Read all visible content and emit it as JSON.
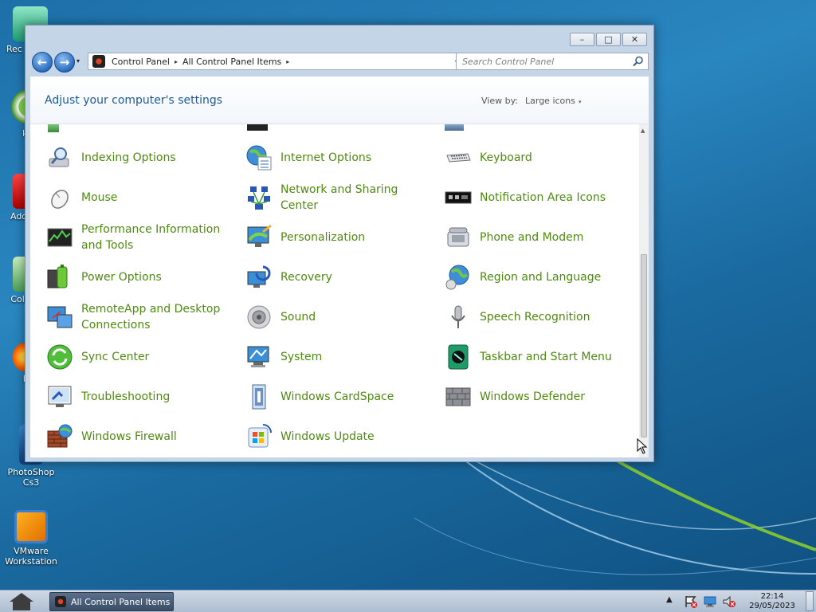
{
  "desktop": {
    "icons": [
      {
        "label": "Rec"
      },
      {
        "label": "µT"
      },
      {
        "label": "Adob"
      },
      {
        "label": "Colla"
      },
      {
        "label": "Fi"
      },
      {
        "label": "PhotoShop Cs3"
      },
      {
        "label": "VMware Workstation"
      }
    ]
  },
  "window": {
    "caption_buttons": {
      "minimize": "–",
      "maximize": "□",
      "close": "✕"
    },
    "nav": {
      "back": "←",
      "forward": "→",
      "dropdown": "▾"
    },
    "address": {
      "crumbs": [
        "Control Panel",
        "All Control Panel Items"
      ],
      "separator": "▸",
      "dropdown": "▾",
      "refresh": "⇆"
    },
    "search": {
      "placeholder": "Search Control Panel"
    },
    "header": {
      "title": "Adjust your computer's settings",
      "view_by_label": "View by:",
      "view_by_value": "Large icons",
      "view_by_caret": "▾"
    },
    "items": [
      {
        "label": "Indexing Options",
        "icon": "indexing-icon"
      },
      {
        "label": "Internet Options",
        "icon": "internet-options-icon"
      },
      {
        "label": "Keyboard",
        "icon": "keyboard-icon"
      },
      {
        "label": "Mouse",
        "icon": "mouse-icon"
      },
      {
        "label": "Network and Sharing Center",
        "icon": "network-icon"
      },
      {
        "label": "Notification Area Icons",
        "icon": "notification-icon"
      },
      {
        "label": "Performance Information and Tools",
        "icon": "performance-icon"
      },
      {
        "label": "Personalization",
        "icon": "personalization-icon"
      },
      {
        "label": "Phone and Modem",
        "icon": "phone-icon"
      },
      {
        "label": "Power Options",
        "icon": "power-icon"
      },
      {
        "label": "Recovery",
        "icon": "recovery-icon"
      },
      {
        "label": "Region and Language",
        "icon": "region-icon"
      },
      {
        "label": "RemoteApp and Desktop Connections",
        "icon": "remoteapp-icon"
      },
      {
        "label": "Sound",
        "icon": "sound-icon"
      },
      {
        "label": "Speech Recognition",
        "icon": "microphone-icon"
      },
      {
        "label": "Sync Center",
        "icon": "sync-icon"
      },
      {
        "label": "System",
        "icon": "system-icon"
      },
      {
        "label": "Taskbar and Start Menu",
        "icon": "taskbar-icon"
      },
      {
        "label": "Troubleshooting",
        "icon": "troubleshooting-icon"
      },
      {
        "label": "Windows CardSpace",
        "icon": "cardspace-icon"
      },
      {
        "label": "Windows Defender",
        "icon": "defender-icon"
      },
      {
        "label": "Windows Firewall",
        "icon": "firewall-icon"
      },
      {
        "label": "Windows Update",
        "icon": "windows-update-icon"
      }
    ],
    "colors": {
      "item_link": "#4f8a10",
      "title": "#1e5a9a"
    }
  },
  "taskbar": {
    "task_label": "All Control Panel Items",
    "tray_arrow": "▲",
    "time": "22:14",
    "date": "29/05/2023"
  }
}
